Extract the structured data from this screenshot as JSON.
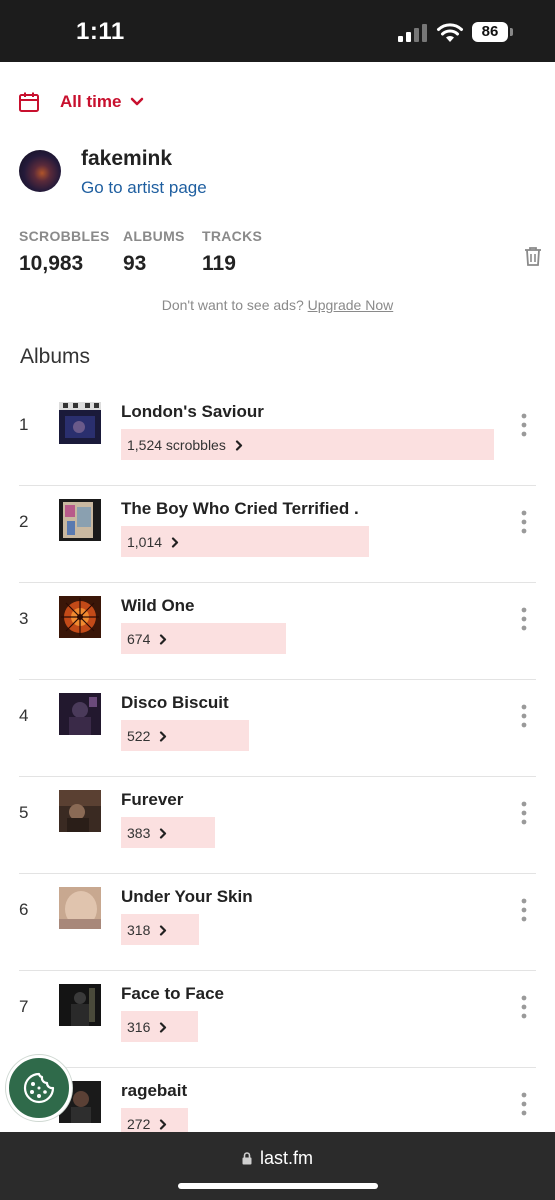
{
  "status_bar": {
    "time": "1:11",
    "battery": "86"
  },
  "filter": {
    "icon": "calendar-icon",
    "label": "All time",
    "accent": "#c8102e"
  },
  "artist": {
    "name": "fakemink",
    "link": "Go to artist page"
  },
  "stats": [
    {
      "label": "SCROBBLES",
      "value": "10,983"
    },
    {
      "label": "ALBUMS",
      "value": "93"
    },
    {
      "label": "TRACKS",
      "value": "119"
    }
  ],
  "ad": {
    "prefix": "Don't want to see ads?",
    "link": "Upgrade Now"
  },
  "section_title": "Albums",
  "albums": [
    {
      "rank": "1",
      "name": "London's Saviour",
      "count": "1,524 scrobbles",
      "scrobbles": 1524
    },
    {
      "rank": "2",
      "name": "The Boy Who Cried Terrified .",
      "count": "1,014",
      "scrobbles": 1014
    },
    {
      "rank": "3",
      "name": "Wild One",
      "count": "674",
      "scrobbles": 674
    },
    {
      "rank": "4",
      "name": "Disco Biscuit",
      "count": "522",
      "scrobbles": 522
    },
    {
      "rank": "5",
      "name": "Furever",
      "count": "383",
      "scrobbles": 383
    },
    {
      "rank": "6",
      "name": "Under Your Skin",
      "count": "318",
      "scrobbles": 318
    },
    {
      "rank": "7",
      "name": "Face to Face",
      "count": "316",
      "scrobbles": 316
    },
    {
      "rank": "8",
      "name": "ragebait",
      "count": "272",
      "scrobbles": 272
    }
  ],
  "browser": {
    "url": "last.fm"
  },
  "colors": {
    "bar_fill": "#fbe0e0",
    "link_blue": "#1f5fa0",
    "cookie_green": "#2f6a4a"
  }
}
